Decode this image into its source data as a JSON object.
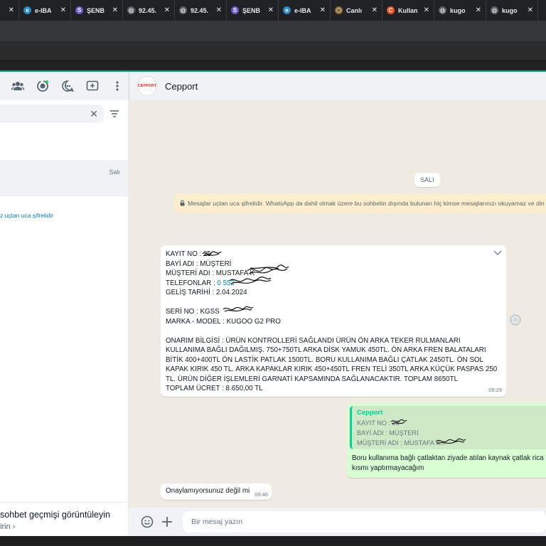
{
  "browser": {
    "tabs": [
      {
        "label": "",
        "favicon": "tab-fragment-icon",
        "color": "#202124"
      },
      {
        "label": "e-IBA",
        "favicon": "e-icon",
        "color": "#2b8cc4"
      },
      {
        "label": "ŞENB",
        "favicon": "s-icon",
        "color": "#6a5acd"
      },
      {
        "label": "92.45.",
        "favicon": "globe-icon",
        "color": "#5f6368"
      },
      {
        "label": "92.45.",
        "favicon": "globe-icon",
        "color": "#5f6368"
      },
      {
        "label": "ŞENB",
        "favicon": "s-icon",
        "color": "#6a5acd"
      },
      {
        "label": "e-IBA",
        "favicon": "e-icon",
        "color": "#2b8cc4"
      },
      {
        "label": "Canlı",
        "favicon": "hex-icon",
        "color": "#8a6d3b"
      },
      {
        "label": "Kullan",
        "favicon": "c-icon",
        "color": "#f4511e"
      },
      {
        "label": "kugo",
        "favicon": "globe-icon",
        "color": "#5f6368"
      },
      {
        "label": "kugo",
        "favicon": "globe-icon",
        "color": "#5f6368"
      }
    ]
  },
  "sidebar": {
    "search_value": "",
    "chat_day": "Salı",
    "enc_note": "z uçtan uca şifrelidir",
    "history_title": "sohbet geçmişi görüntüleyin",
    "history_sub": "irin"
  },
  "conversation": {
    "contact_name": "Cepport",
    "avatar_text": "CEPPORT",
    "day_chip": "SALI",
    "encryption_banner": "Mesajlar uçtan uca şifrelidir. WhatsApp da dahil olmak üzere bu sohbetin dışında bulunan hiç kimse mesajlarınızı okuyamaz ve din",
    "msg1": {
      "lines": [
        "KAYIT NO : 25",
        "BAYİ ADI : MÜŞTERİ",
        "MÜŞTERİ ADI : MUSTAFA K",
        "TELEFONLAR : ",
        "GELİŞ TARİHİ : 2.04.2024",
        "",
        "SERİ NO : KGSS",
        "MARKA - MODEL : KUGOO G2 PRO",
        ""
      ],
      "phone": "0 552",
      "paragraph": "ONARIM BİLGİSİ : ÜRÜN KONTROLLERİ SAĞLANDI ÜRÜN ÖN ARKA TEKER RULMANLARI KULLANIMA BAĞLI DAĞILMIŞ. 750+750TL ARKA DİSK YAMUK 450TL. ÖN ARKA FREN BALATALARI BİTİK 400+400TL ÖN LASTİK PATLAK 1500TL. BORU KULLANIMA BAĞLI ÇATLAK 2450TL. ÖN SOL KAPAK KIRIK 450 TL. ARKA KAPAKLAR KIRIK 450+450TL FREN TELİ 350TL ARKA KÜÇÜK PASPAS 250 TL. ÜRÜN DİĞER İŞLEMLERİ GARNATİ KAPSAMINDA SAĞLANACAKTIR. TOPLAM 8650TL",
      "total": "TOPLAM ÜCRET : 8.650,00 TL",
      "time": "09:29"
    },
    "msg2": {
      "quote_name": "Cepport",
      "quote_lines": [
        "KAYIT NO : 25",
        "BAYİ ADI : MÜŞTERİ",
        "MÜŞTERİ ADI : MUSTAFA K..."
      ],
      "body": "Boru kullanıma bağlı çatlaktan ziyade atılan kaynak çatlak rica kısmı yaptırmayacağım"
    },
    "msg3": {
      "text": "Onaylamıyorsunuz değil mi",
      "time": "09:46"
    },
    "composer_placeholder": "Bir mesaj yazın"
  },
  "colors": {
    "accent": "#00a884",
    "incoming": "#ffffff",
    "outgoing": "#d9fdd3",
    "chat_bg": "#efeae2",
    "banner": "#ffeecd"
  }
}
